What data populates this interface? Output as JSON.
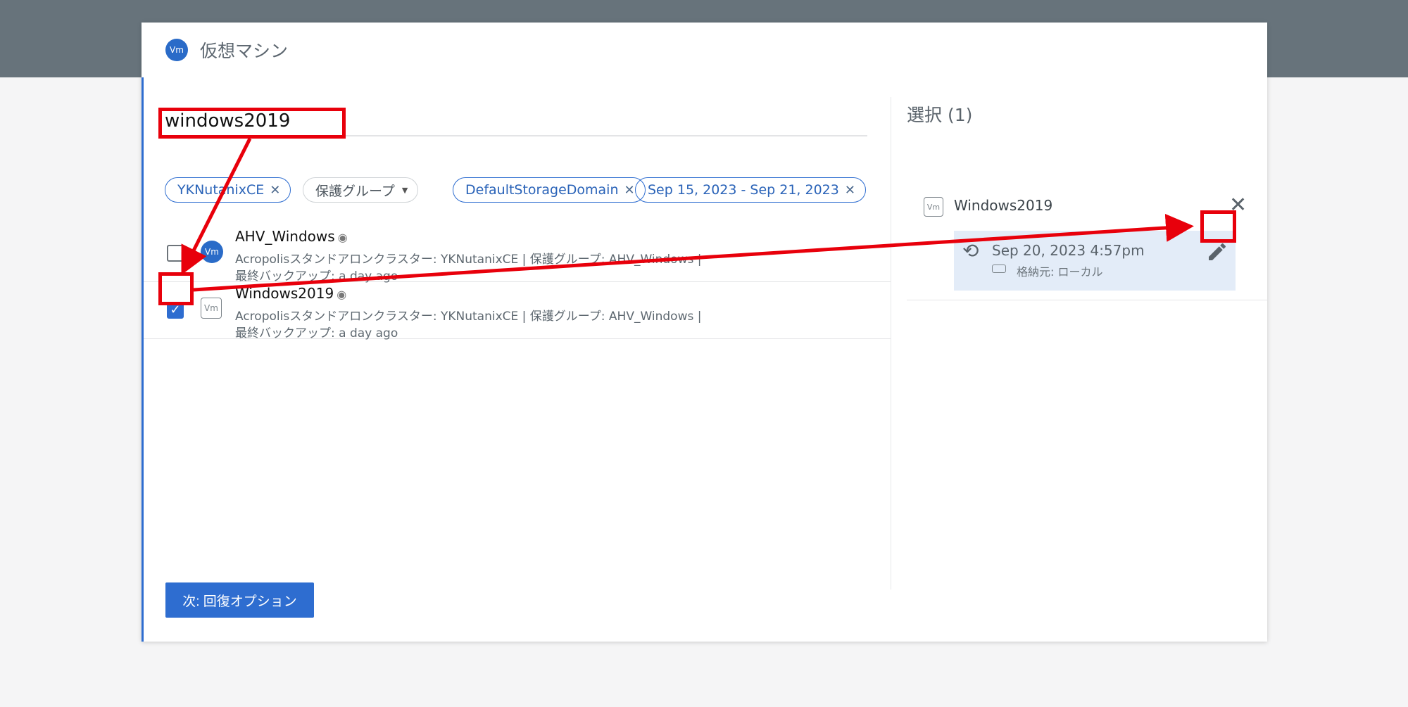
{
  "header": {
    "avatar_text": "Vm",
    "title": "仮想マシン"
  },
  "search": {
    "value": "windows2019"
  },
  "filters": {
    "cluster": "YKNutanixCE",
    "protection_group": "保護グループ",
    "storage_domain": "DefaultStorageDomain",
    "date_range": "Sep 15, 2023 - Sep 21, 2023"
  },
  "rows": [
    {
      "name": "AHV_Windows",
      "avatar_text": "Vm",
      "meta_line1": "Acropolisスタンドアロンクラスター:  YKNutanixCE   |   保護グループ:  AHV_Windows   |",
      "meta_line2": "最終バックアップ: a day ago",
      "checked": false
    },
    {
      "name": "Windows2019",
      "avatar_text": "Vm",
      "meta_line1": "Acropolisスタンドアロンクラスター:  YKNutanixCE   |   保護グループ:  AHV_Windows   |",
      "meta_line2": "最終バックアップ: a day ago",
      "checked": true
    }
  ],
  "selection": {
    "title": "選択 (1)",
    "item_icon_text": "Vm",
    "item_name": "Windows2019",
    "snapshot_time": "Sep 20, 2023 4:57pm",
    "snapshot_location": "格納元: ローカル"
  },
  "footer": {
    "next_label": "次: 回復オプション"
  },
  "colors": {
    "accent": "#2e6dd0",
    "annotation": "#e8000b",
    "top_band": "#67737b"
  },
  "icons": [
    "history-icon",
    "storage-icon",
    "pencil-icon",
    "close-icon",
    "eye-icon",
    "checkmark-icon"
  ]
}
